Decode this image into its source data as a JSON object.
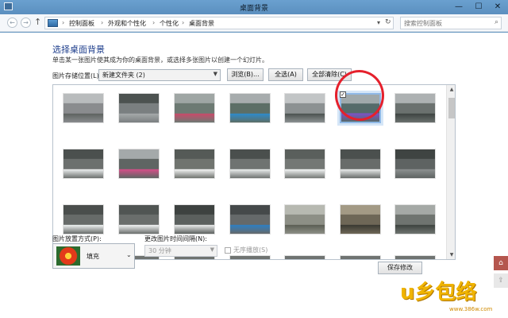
{
  "window": {
    "title": "桌面背景",
    "controls": {
      "minimize": "—",
      "maximize": "☐",
      "close": "✕"
    }
  },
  "nav": {
    "breadcrumbs": [
      "控制面板",
      "外观和个性化",
      "个性化",
      "桌面背景"
    ],
    "search_placeholder": "搜索控制面板"
  },
  "page": {
    "heading": "选择桌面背景",
    "description": "单击某一张图片使其成为你的桌面背景，或选择多张图片以创建一个幻灯片。"
  },
  "location": {
    "label": "图片存储位置(L):",
    "value": "新建文件夹 (2)"
  },
  "buttons": {
    "browse": "浏览(B)...",
    "select_all": "全选(A)",
    "clear_all": "全部清除(C)",
    "save": "保存修改"
  },
  "thumbnails": [
    {
      "row": 0,
      "col": 0,
      "selected": false,
      "palette": [
        "#8a8c8e",
        "#5f6461",
        "#b9bcbd"
      ]
    },
    {
      "row": 0,
      "col": 1,
      "selected": false,
      "palette": [
        "#7a7f80",
        "#a4a8a9",
        "#4c5250"
      ]
    },
    {
      "row": 0,
      "col": 2,
      "selected": false,
      "palette": [
        "#6d7a73",
        "#c74b6a",
        "#9fa6a4"
      ]
    },
    {
      "row": 0,
      "col": 3,
      "selected": false,
      "palette": [
        "#5c6e66",
        "#2f8ac9",
        "#a7acad"
      ]
    },
    {
      "row": 0,
      "col": 4,
      "selected": false,
      "palette": [
        "#8c9192",
        "#4c5351",
        "#c2c5c6"
      ]
    },
    {
      "row": 0,
      "col": 5,
      "selected": true,
      "palette": [
        "#556b6a",
        "#7d52c7",
        "#a0a9ab"
      ]
    },
    {
      "row": 0,
      "col": 6,
      "selected": false,
      "palette": [
        "#6b716f",
        "#3e4542",
        "#adb1b2"
      ]
    },
    {
      "row": 1,
      "col": 0,
      "selected": false,
      "palette": [
        "#6c706e",
        "#e9ecec",
        "#4b504e"
      ]
    },
    {
      "row": 1,
      "col": 1,
      "selected": false,
      "palette": [
        "#5f6563",
        "#d24f88",
        "#a4a9aa"
      ]
    },
    {
      "row": 1,
      "col": 2,
      "selected": false,
      "palette": [
        "#70746f",
        "#f1f2f2",
        "#555a57"
      ]
    },
    {
      "row": 1,
      "col": 3,
      "selected": false,
      "palette": [
        "#6f7371",
        "#e8ebeb",
        "#4a4f4d"
      ]
    },
    {
      "row": 1,
      "col": 4,
      "selected": false,
      "palette": [
        "#747875",
        "#f0f2f2",
        "#5a5f5c"
      ]
    },
    {
      "row": 1,
      "col": 5,
      "selected": false,
      "palette": [
        "#686c6a",
        "#e7e9e9",
        "#4b504e"
      ]
    },
    {
      "row": 1,
      "col": 6,
      "selected": false,
      "palette": [
        "#5e6362",
        "#8b8f8f",
        "#3f4442"
      ]
    },
    {
      "row": 2,
      "col": 0,
      "selected": false,
      "palette": [
        "#676b69",
        "#ecefef",
        "#4a4e4c"
      ]
    },
    {
      "row": 2,
      "col": 1,
      "selected": false,
      "palette": [
        "#6a6e6c",
        "#eff1f1",
        "#505553"
      ]
    },
    {
      "row": 2,
      "col": 2,
      "selected": false,
      "palette": [
        "#5b605e",
        "#e8eaea",
        "#3d4240"
      ]
    },
    {
      "row": 2,
      "col": 3,
      "selected": false,
      "palette": [
        "#65696a",
        "#2f7fc0",
        "#45494a"
      ]
    },
    {
      "row": 2,
      "col": 4,
      "selected": false,
      "palette": [
        "#8d8f86",
        "#5c5f55",
        "#b7b9b1"
      ]
    },
    {
      "row": 2,
      "col": 5,
      "selected": false,
      "palette": [
        "#6e6757",
        "#3b3a33",
        "#a39a85"
      ]
    },
    {
      "row": 2,
      "col": 6,
      "selected": false,
      "palette": [
        "#6f7470",
        "#3e4440",
        "#a5a9a6"
      ]
    }
  ],
  "position": {
    "label": "图片放置方式(P):",
    "value": "填充"
  },
  "interval": {
    "label": "更改图片时间间隔(N):",
    "value": "30 分钟"
  },
  "shuffle": {
    "label": "无序播放(S)"
  },
  "watermark": {
    "logo": "u乡包络",
    "url": "www.386w.com"
  }
}
